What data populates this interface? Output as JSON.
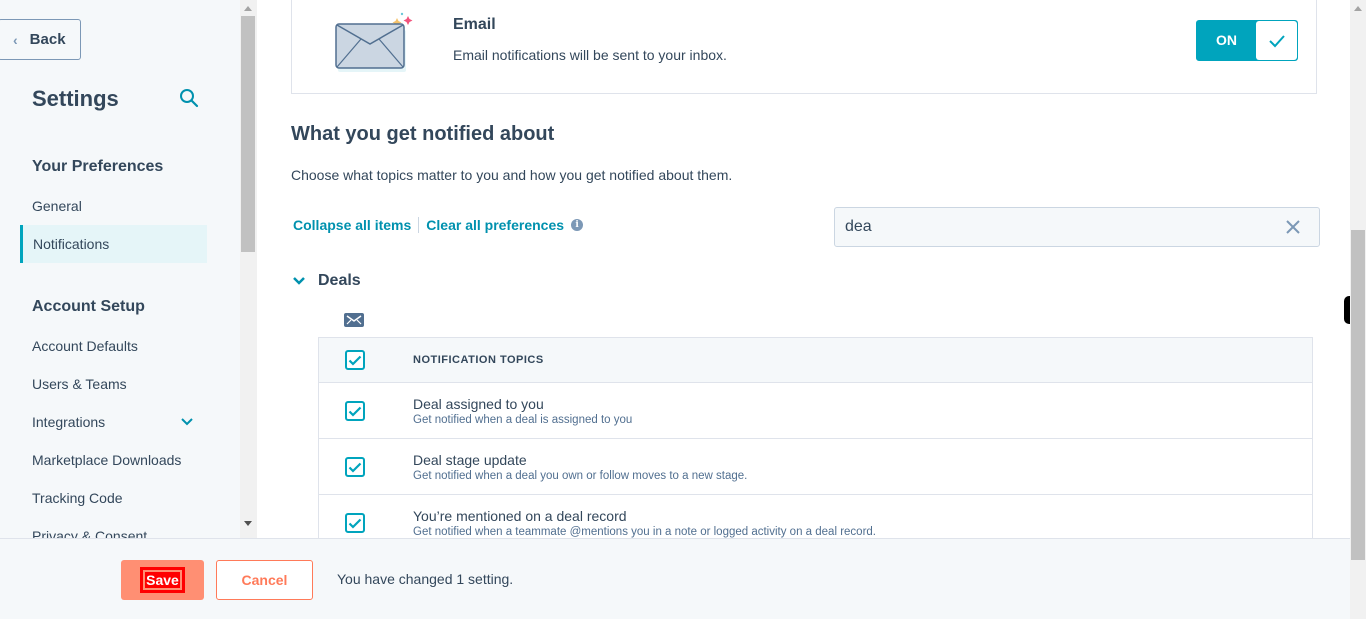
{
  "sidebar": {
    "back_label": "Back",
    "title": "Settings",
    "groups": [
      {
        "label": "Your Preferences"
      },
      {
        "label": "Account Setup"
      }
    ],
    "items": [
      {
        "label": "General"
      },
      {
        "label": "Notifications",
        "active": true
      },
      {
        "label": "Account Defaults"
      },
      {
        "label": "Users & Teams"
      },
      {
        "label": "Integrations"
      },
      {
        "label": "Marketplace Downloads"
      },
      {
        "label": "Tracking Code"
      },
      {
        "label": "Privacy & Consent"
      }
    ]
  },
  "email": {
    "title": "Email",
    "description": "Email notifications will be sent to your inbox.",
    "toggle_label": "ON",
    "toggle_on": true
  },
  "section": {
    "title": "What you get notified about",
    "subtitle": "Choose what topics matter to you and how you get notified about them.",
    "collapse_label": "Collapse all items",
    "clear_label": "Clear all preferences",
    "search_value": "dea"
  },
  "deals": {
    "title": "Deals",
    "header": "NOTIFICATION TOPICS",
    "rows": [
      {
        "title": "Deal assigned to you",
        "desc": "Get notified when a deal is assigned to you",
        "checked": true
      },
      {
        "title": "Deal stage update",
        "desc": "Get notified when a deal you own or follow moves to a new stage.",
        "checked": true
      },
      {
        "title": "You’re mentioned on a deal record",
        "desc": "Get notified when a teammate @mentions you in a note or logged activity on a deal record.",
        "checked": true
      }
    ]
  },
  "footer": {
    "save_label": "Save",
    "cancel_label": "Cancel",
    "status": "You have changed 1 setting."
  },
  "colors": {
    "accent": "#00a4bd",
    "link": "#0091ae",
    "save": "#ff8f73",
    "cancel": "#ff7a59"
  }
}
